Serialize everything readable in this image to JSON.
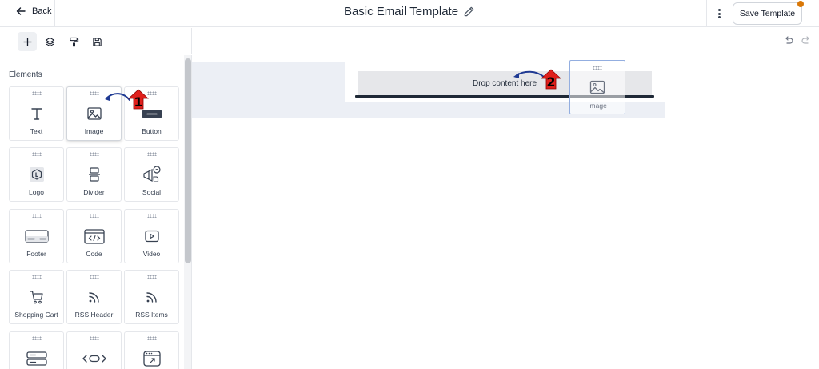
{
  "header": {
    "back_label": "Back",
    "title": "Basic Email Template",
    "save_label": "Save Template"
  },
  "toolbar": {
    "tools": [
      "plus-icon",
      "layers-icon",
      "paint-roller-icon",
      "save-icon"
    ],
    "canvas_tools": [
      "undo-icon",
      "redo-icon"
    ]
  },
  "sidebar": {
    "section_title": "Elements",
    "elements": [
      {
        "label": "Text",
        "icon": "text-icon"
      },
      {
        "label": "Image",
        "icon": "image-icon"
      },
      {
        "label": "Button",
        "icon": "button-icon"
      },
      {
        "label": "Logo",
        "icon": "logo-icon"
      },
      {
        "label": "Divider",
        "icon": "divider-icon"
      },
      {
        "label": "Social",
        "icon": "social-icon"
      },
      {
        "label": "Footer",
        "icon": "footer-icon"
      },
      {
        "label": "Code",
        "icon": "code-icon"
      },
      {
        "label": "Video",
        "icon": "video-icon"
      },
      {
        "label": "Shopping Cart",
        "icon": "shopping-cart-icon"
      },
      {
        "label": "RSS Header",
        "icon": "rss-icon"
      },
      {
        "label": "RSS Items",
        "icon": "rss-icon"
      },
      {
        "label": "",
        "icon": "server-icon"
      },
      {
        "label": "",
        "icon": "custom-code-icon"
      },
      {
        "label": "",
        "icon": "browser-window-icon"
      }
    ]
  },
  "canvas": {
    "drop_placeholder": "Drop content here",
    "drag_ghost_label": "Image"
  },
  "annotations": {
    "marker_1": "1",
    "marker_2": "2"
  },
  "colors": {
    "accent_marker": "#e0201c",
    "arrow": "#1f3a93",
    "notification_dot": "#d97706",
    "canvas_band": "#eceff5",
    "ghost_border": "#93aee0"
  }
}
